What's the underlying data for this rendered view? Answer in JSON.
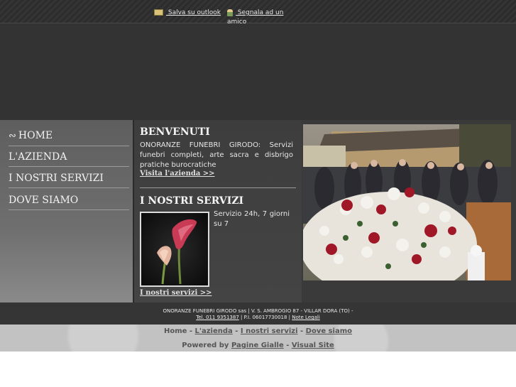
{
  "top": {
    "outlook_label": " Salva su outlook",
    "segnala_label": " Segnala ad un amico"
  },
  "nav": {
    "items": [
      {
        "label": "HOME"
      },
      {
        "label": "L'AZIENDA"
      },
      {
        "label": "I NOSTRI SERVIZI"
      },
      {
        "label": "DOVE SIAMO"
      }
    ]
  },
  "welcome": {
    "title": "BENVENUTI",
    "text": "ONORANZE FUNEBRI GIRODO: Servizi funebri completi, arte sacra e disbrigo pratiche burocratiche",
    "link": "Visita l'azienda >>"
  },
  "services": {
    "title": "I NOSTRI SERVIZI",
    "text": "Servizio 24h, 7 giorni su 7",
    "link": "I nostri servizi >>"
  },
  "footer": {
    "line1": "ONORANZE FUNEBRI GIRODO sas | V. S. AMBROGIO 87 - VILLAR DORA (TO) -",
    "tel": "Tel. 011 9351387",
    "piva": " | P.I. 06017730018 | ",
    "legal": "Note Legali",
    "nav": {
      "home": "Home",
      "sep": " - ",
      "azienda": "L'azienda",
      "servizi": "I nostri servizi",
      "dove": "Dove siamo"
    },
    "powered_prefix": "Powered by ",
    "pagine": " Pagine Gialle",
    "visual": "Visual Site"
  },
  "colors": {
    "background_dark": "#333333",
    "sidebar": "#6f6f6f",
    "footer_light": "#c2c2c2"
  }
}
